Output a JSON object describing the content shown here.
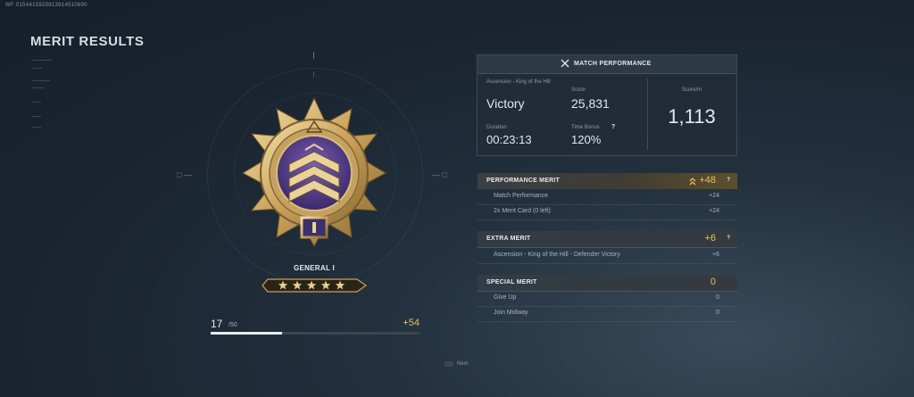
{
  "uid": "WF 0154415920913914510890",
  "page_title": "MERIT RESULTS",
  "rank": {
    "name": "GENERAL I",
    "stars": 5,
    "progress_current": "17",
    "progress_max": "/50",
    "progress_gain": "+54",
    "progress_fraction": 0.34
  },
  "match_performance": {
    "header": "MATCH PERFORMANCE",
    "mode": "Ascension - King of the Hill",
    "result": "Victory",
    "score_label": "Score",
    "score": "25,831",
    "duration_label": "Duration",
    "duration": "00:23:13",
    "time_bonus_label": "Time Bonus",
    "time_bonus_help": "?",
    "time_bonus": "120%",
    "score_per_min_label": "Score/m",
    "score_per_min": "1,113"
  },
  "performance_merit": {
    "title": "PERFORMANCE MERIT",
    "total": "+48",
    "help": "?",
    "rows": [
      {
        "name": "Match Performance",
        "value": "+24"
      },
      {
        "name": "2x Merit Card (0 left)",
        "value": "+24"
      }
    ]
  },
  "extra_merit": {
    "title": "EXTRA MERIT",
    "total": "+6",
    "help": "?",
    "rows": [
      {
        "name": "Ascension - King of the Hill - Defender Victory",
        "value": "+6"
      }
    ]
  },
  "special_merit": {
    "title": "SPECIAL MERIT",
    "total": "0",
    "rows": [
      {
        "name": "Give Up",
        "value": "0"
      },
      {
        "name": "Join Midway",
        "value": "0"
      }
    ]
  },
  "footer": {
    "next_label": "Next"
  },
  "colors": {
    "accent_gold": "#e8c15a",
    "merit_gold_bg": "#5c4f2c",
    "medal_purple": "#5a3f8c"
  }
}
